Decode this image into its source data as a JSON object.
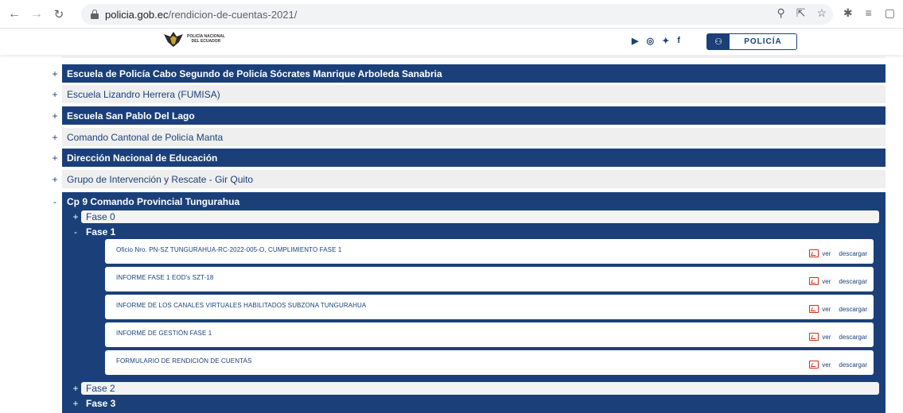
{
  "browser": {
    "url_host": "policia.gob.ec",
    "url_path": "/rendicion-de-cuentas-2021/",
    "back_icon": "arrow-left-icon",
    "forward_icon": "arrow-right-icon",
    "reload_icon": "reload-icon"
  },
  "site": {
    "logo_line1": "POLICÍA NACIONAL",
    "logo_line2": "DEL ECUADOR",
    "social": [
      "youtube-icon",
      "instagram-icon",
      "twitter-icon",
      "facebook-icon"
    ],
    "policia_button": "POLICÍA"
  },
  "accordion": [
    {
      "sign": "+",
      "label": "Escuela de Policía Cabo Segundo de Policía Sócrates Manrique Arboleda Sanabria",
      "style": "dark"
    },
    {
      "sign": "+",
      "label": "Escuela Lizandro Herrera (FUMISA)",
      "style": "light"
    },
    {
      "sign": "+",
      "label": "Escuela San Pablo Del Lago",
      "style": "dark"
    },
    {
      "sign": "+",
      "label": "Comando Cantonal de Policía Manta",
      "style": "light"
    },
    {
      "sign": "+",
      "label": "Dirección Nacional de Educación",
      "style": "dark"
    },
    {
      "sign": "+",
      "label": "Grupo de Intervención y Rescate - Gir Quito",
      "style": "light"
    }
  ],
  "expanded": {
    "sign": "-",
    "label": "Cp 9 Comando Provincial Tungurahua",
    "fases": [
      {
        "sign": "+",
        "label": "Fase 0"
      },
      {
        "sign": "-",
        "label": "Fase 1"
      },
      {
        "sign": "+",
        "label": "Fase 2"
      },
      {
        "sign": "+",
        "label": "Fase 3"
      }
    ],
    "documents": [
      "Oficio Nro. PN-SZ TUNGURAHUA-RC-2022-005-O, CUMPLIMIENTO FASE 1",
      "INFORME FASE 1 EOD's SZT-18",
      "INFORME DE LOS CANALES VIRTUALES HABILITADOS SUBZONA TUNGURAHUA",
      "INFORME DE GESTIÓN FASE 1",
      "FORMULARIO DE RENDICIÓN DE CUENTAS"
    ],
    "ver_label": "ver",
    "descargar_label": "descargar"
  }
}
